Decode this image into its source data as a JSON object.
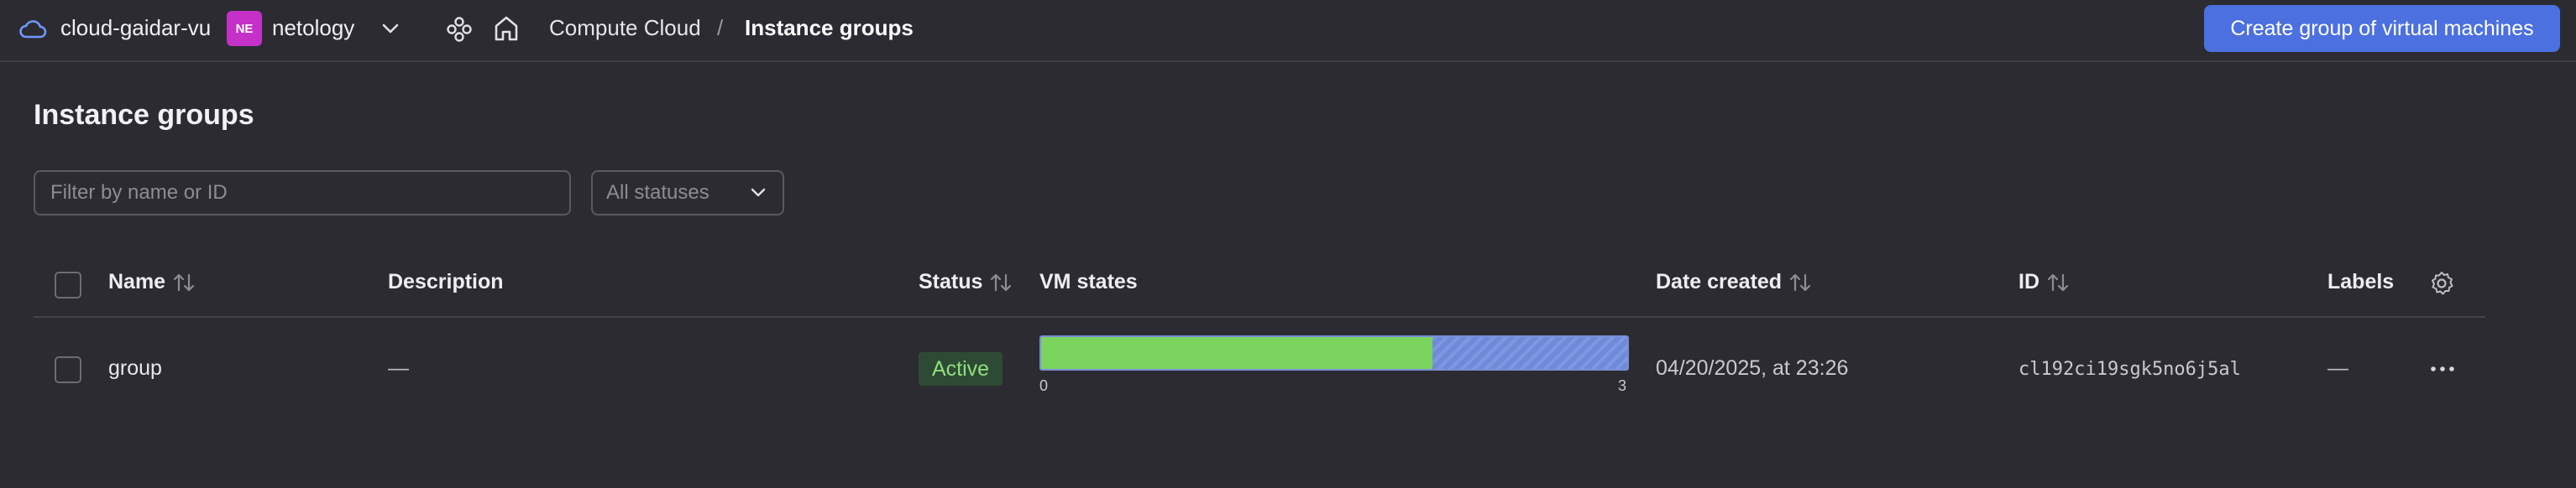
{
  "header": {
    "cloud_name": "cloud-gaidar-vu",
    "org_badge": "NE",
    "org_name": "netology",
    "breadcrumb": {
      "service": "Compute Cloud",
      "separator": "/",
      "current": "Instance groups"
    },
    "create_button": "Create group of virtual machines"
  },
  "page": {
    "title": "Instance groups",
    "filter_placeholder": "Filter by name or ID",
    "status_filter": "All statuses"
  },
  "table": {
    "columns": {
      "name": "Name",
      "description": "Description",
      "status": "Status",
      "vm_states": "VM states",
      "date_created": "Date created",
      "id": "ID",
      "labels": "Labels"
    },
    "rows": [
      {
        "name": "group",
        "description": "—",
        "status": "Active",
        "vm_states": {
          "running_fraction": 0.667,
          "min": "0",
          "max": "3"
        },
        "date_created": "04/20/2025, at 23:26",
        "id": "cl192ci19sgk5no6j5al",
        "labels": "—"
      }
    ]
  },
  "colors": {
    "accent": "#4c70e0",
    "running": "#7ad45e",
    "other_state": "#6f8ad8",
    "active_badge_bg": "#2f4a34",
    "active_badge_text": "#8de07e",
    "org_badge": "#c530c8"
  },
  "icons": [
    "cloud-icon",
    "chevron-down-icon",
    "nodes-icon",
    "home-icon",
    "sort-icon",
    "gear-icon",
    "more-horizontal-icon"
  ]
}
